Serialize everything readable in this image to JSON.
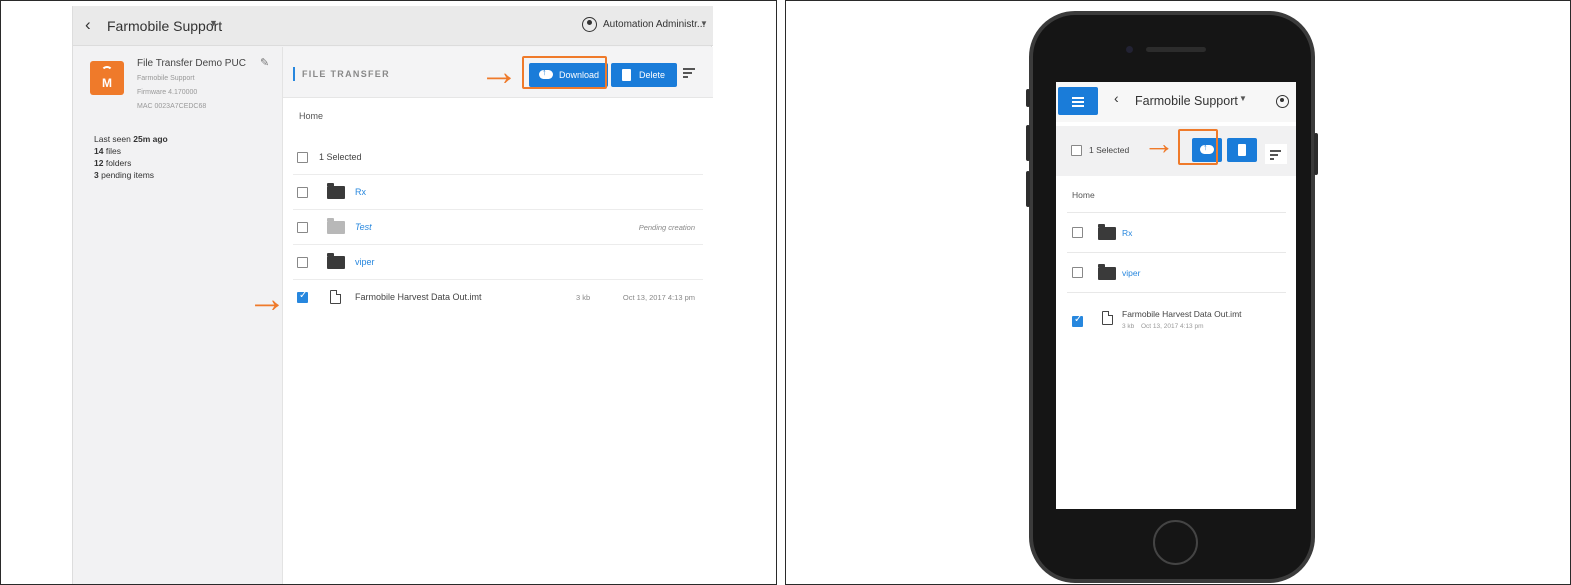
{
  "desktop": {
    "topbar": {
      "back_glyph": "‹",
      "org_name": "Farmobile Support",
      "org_caret": "▼",
      "user_name": "Automation Administr...",
      "user_caret": "▼"
    },
    "device": {
      "name": "File Transfer Demo PUC",
      "org": "Farmobile Support",
      "firmware": "Firmware 4.170000",
      "mac": "MAC 0023A7CEDC68",
      "logo_letter": "M",
      "edit_glyph": "✎"
    },
    "stats": {
      "last_seen_label": "Last seen",
      "last_seen_value": "25m ago",
      "files_count": "14",
      "files_label": "files",
      "folders_count": "12",
      "folders_label": "folders",
      "pending_count": "3",
      "pending_label": "pending items"
    },
    "file_transfer": {
      "title": "FILE TRANSFER",
      "download_label": "Download",
      "delete_label": "Delete",
      "breadcrumb": "Home",
      "selected_text": "1 Selected",
      "items": [
        {
          "name": "Rx",
          "type": "folder",
          "checked": false,
          "status": ""
        },
        {
          "name": "Test",
          "type": "folder-pending",
          "checked": false,
          "status": "Pending creation"
        },
        {
          "name": "viper",
          "type": "folder",
          "checked": false,
          "status": ""
        },
        {
          "name": "Farmobile Harvest Data Out.imt",
          "type": "file",
          "checked": true,
          "size": "3 kb",
          "date": "Oct 13, 2017 4:13 pm"
        }
      ]
    }
  },
  "mobile": {
    "topbar": {
      "back_glyph": "‹",
      "org_name": "Farmobile Support",
      "org_caret": "▼"
    },
    "toolbar": {
      "selected_text": "1 Selected"
    },
    "breadcrumb": "Home",
    "items": [
      {
        "name": "Rx",
        "type": "folder",
        "checked": false
      },
      {
        "name": "viper",
        "type": "folder",
        "checked": false
      },
      {
        "name": "Farmobile Harvest Data Out.imt",
        "type": "file",
        "checked": true,
        "size": "3 kb",
        "date": "Oct 13, 2017 4:13 pm"
      }
    ]
  },
  "annotations": {
    "arrow_glyph": "→",
    "highlight_color": "#ef7a2a"
  },
  "colors": {
    "accent_blue": "#1a7cd9",
    "link_blue": "#2787de",
    "brand_orange": "#ef7a2a"
  }
}
